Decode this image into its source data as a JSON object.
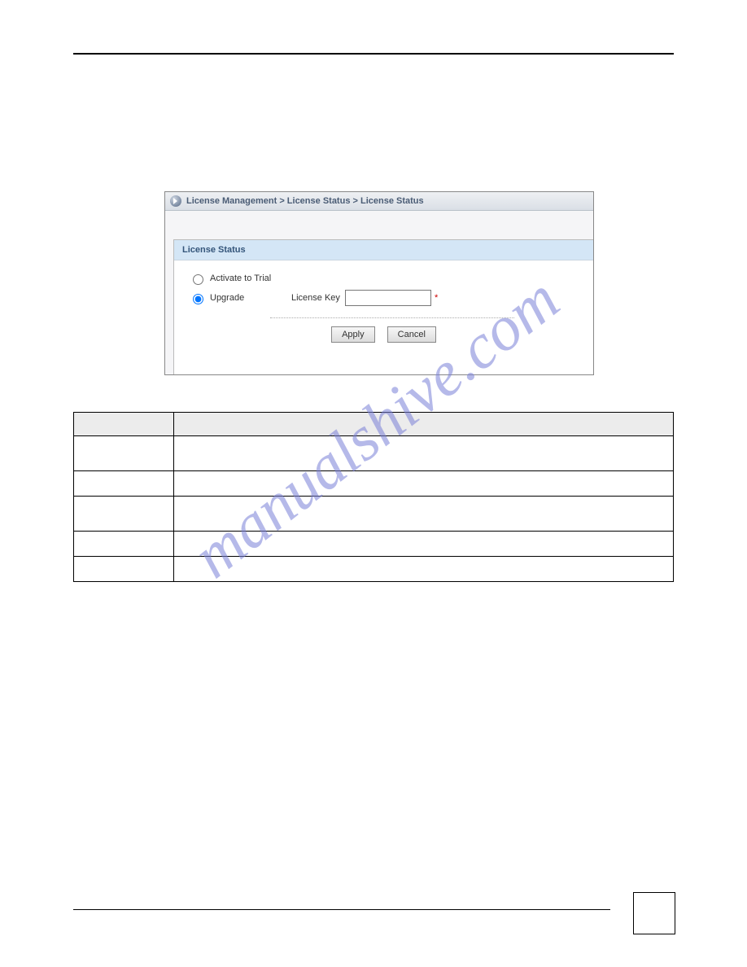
{
  "breadcrumb": {
    "text": "License Management > License Status > License Status"
  },
  "panel": {
    "title": "License Status",
    "options": {
      "activate_trial_label": "Activate to Trial",
      "upgrade_label": "Upgrade",
      "license_key_label": "License Key",
      "required_marker": "*",
      "selected": "upgrade"
    },
    "buttons": {
      "apply": "Apply",
      "cancel": "Cancel"
    }
  },
  "table": {
    "header_label": "",
    "header_desc": "",
    "rows": [
      {
        "label": "",
        "desc": ""
      },
      {
        "label": "",
        "desc": ""
      },
      {
        "label": "",
        "desc": ""
      },
      {
        "label": "",
        "desc": ""
      },
      {
        "label": "",
        "desc": ""
      }
    ]
  },
  "watermark": "manualshive.com"
}
